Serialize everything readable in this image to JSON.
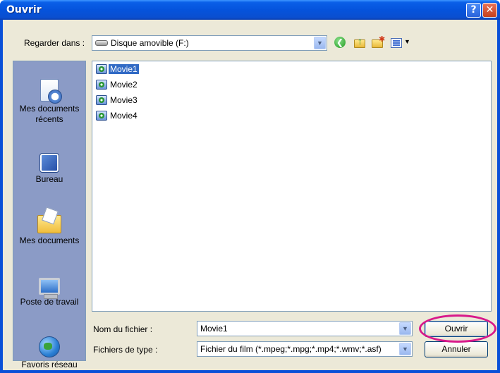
{
  "window": {
    "title": "Ouvrir",
    "help_symbol": "?",
    "close_symbol": "✕"
  },
  "toolbar": {
    "look_in_label": "Regarder dans :",
    "look_in_value": "Disque amovible (F:)",
    "icons": [
      "drive-icon",
      "back-icon",
      "up-folder-icon",
      "new-folder-icon",
      "views-menu-icon"
    ]
  },
  "places": [
    {
      "label": "Mes documents récents",
      "icon": "recent-documents-icon"
    },
    {
      "label": "Bureau",
      "icon": "desktop-icon"
    },
    {
      "label": "Mes documents",
      "icon": "my-documents-icon"
    },
    {
      "label": "Poste de travail",
      "icon": "my-computer-icon"
    },
    {
      "label": "Favoris réseau",
      "icon": "network-places-icon"
    }
  ],
  "places_text": {
    "recent_line1": "Mes documents",
    "recent_line2": "récents",
    "desktop": "Bureau",
    "mydocs": "Mes documents",
    "mycomp": "Poste de travail",
    "network": "Favoris réseau"
  },
  "files": [
    "Movie1",
    "Movie2",
    "Movie3",
    "Movie4"
  ],
  "selected_file": "Movie1",
  "footer": {
    "file_name_label": "Nom du fichier :",
    "file_name_value": "Movie1",
    "file_type_label": "Fichiers de type :",
    "file_type_value": "Fichier du film (*.mpeg;*.mpg;*.mp4;*.wmv;*.asf)",
    "open_label": "Ouvrir",
    "cancel_label": "Annuler"
  },
  "colors": {
    "titlebar": "#0553dc",
    "dialog_bg": "#ece9d8",
    "places_bg": "#8b9bc6",
    "selection": "#316ac5",
    "highlight_ring": "#d8188a"
  }
}
